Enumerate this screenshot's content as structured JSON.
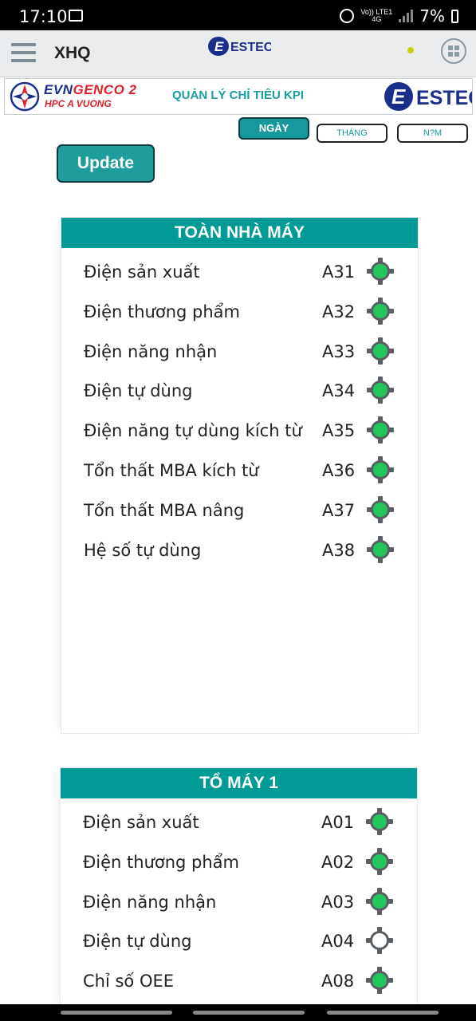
{
  "status_bar": {
    "time": "17:10",
    "network_top": "Vo)) LTE1",
    "network_bottom": "4G",
    "battery": "7%"
  },
  "app_bar": {
    "title": "XHQ",
    "logo_text": "ESTEC"
  },
  "banner": {
    "brand_main": "EVN",
    "brand_accent": "GENCO 2",
    "brand_sub": "HPC A VUONG",
    "title": "QUẢN LÝ CHỈ TIÊU KPI",
    "logo_text": "ESTEC"
  },
  "period": {
    "day": "NGÀY",
    "month": "THÁNG",
    "year": "N?M"
  },
  "update_label": "Update",
  "plant": {
    "title": "TOÀN NHÀ MÁY",
    "rows": [
      {
        "label": "Điện sản xuất",
        "code": "A31",
        "icon": "green-target-icon"
      },
      {
        "label": "Điện thương phẩm",
        "code": "A32",
        "icon": "green-target-icon"
      },
      {
        "label": "Điện năng nhận",
        "code": "A33",
        "icon": "green-target-icon"
      },
      {
        "label": "Điện tự dùng",
        "code": "A34",
        "icon": "green-target-icon"
      },
      {
        "label": "Điện năng tự dùng kích từ",
        "code": "A35",
        "icon": "green-target-icon"
      },
      {
        "label": "Tổn thất MBA kích từ",
        "code": "A36",
        "icon": "green-target-icon"
      },
      {
        "label": "Tổn thất MBA nâng",
        "code": "A37",
        "icon": "green-target-icon"
      },
      {
        "label": "Hệ số tự dùng",
        "code": "A38",
        "icon": "green-target-icon"
      }
    ]
  },
  "unit1": {
    "title": "TỔ MÁY 1",
    "rows": [
      {
        "label": "Điện sản xuất",
        "code": "A01",
        "icon": "green-target-icon"
      },
      {
        "label": "Điện thương phẩm",
        "code": "A02",
        "icon": "green-target-icon"
      },
      {
        "label": "Điện năng nhận",
        "code": "A03",
        "icon": "green-target-icon"
      },
      {
        "label": "Điện tự dùng",
        "code": "A04",
        "icon": "white-target-icon"
      },
      {
        "label": "Chỉ số OEE",
        "code": "A08",
        "icon": "green-target-icon"
      }
    ]
  },
  "colors": {
    "teal": "#009a97",
    "status_green": "#22c55e",
    "status_white": "#ffffff"
  }
}
